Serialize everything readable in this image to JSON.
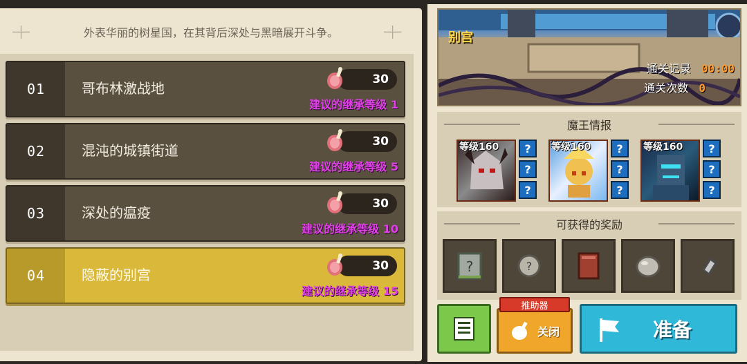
{
  "header": {
    "text": "外表华丽的树星国，在其背后深处与黑暗展开斗争。"
  },
  "stages": [
    {
      "num": "01",
      "name": "哥布林激战地",
      "cost": "30",
      "level": "建议的继承等级 1",
      "selected": false
    },
    {
      "num": "02",
      "name": "混沌的城镇街道",
      "cost": "30",
      "level": "建议的继承等级 5",
      "selected": false
    },
    {
      "num": "03",
      "name": "深处的瘟疫",
      "cost": "30",
      "level": "建议的继承等级 10",
      "selected": false
    },
    {
      "num": "04",
      "name": "隐蔽的别宫",
      "cost": "30",
      "level": "建议的继承等级 15",
      "selected": true
    }
  ],
  "preview": {
    "title": "别宫",
    "clear_record_label": "通关记录",
    "clear_record_value": "00:00",
    "clear_count_label": "通关次数",
    "clear_count_value": "0"
  },
  "boss_section": {
    "title": "魔王情报",
    "bosses": [
      {
        "level": "等级160",
        "icon": "demon-boss-portrait"
      },
      {
        "level": "等级160",
        "icon": "sun-knight-portrait"
      },
      {
        "level": "等级160",
        "icon": "cyber-golem-portrait"
      }
    ],
    "hidden_mark": "?"
  },
  "reward_section": {
    "title": "可获得的奖励",
    "rewards": [
      {
        "icon": "mystery-scroll-icon"
      },
      {
        "icon": "mystery-coin-icon"
      },
      {
        "icon": "red-book-icon"
      },
      {
        "icon": "stone-ore-icon"
      },
      {
        "icon": "metal-shard-icon"
      }
    ]
  },
  "buttons": {
    "list_icon": "list-icon",
    "booster_tag": "推助器",
    "booster_state": "关闭",
    "ready_label": "准备"
  },
  "colors": {
    "selected_stage": "#d9b83a",
    "level_text": "#e040e8",
    "ready_button": "#2fb8d8",
    "booster_button": "#f0a62a",
    "list_button": "#7cc84a"
  }
}
